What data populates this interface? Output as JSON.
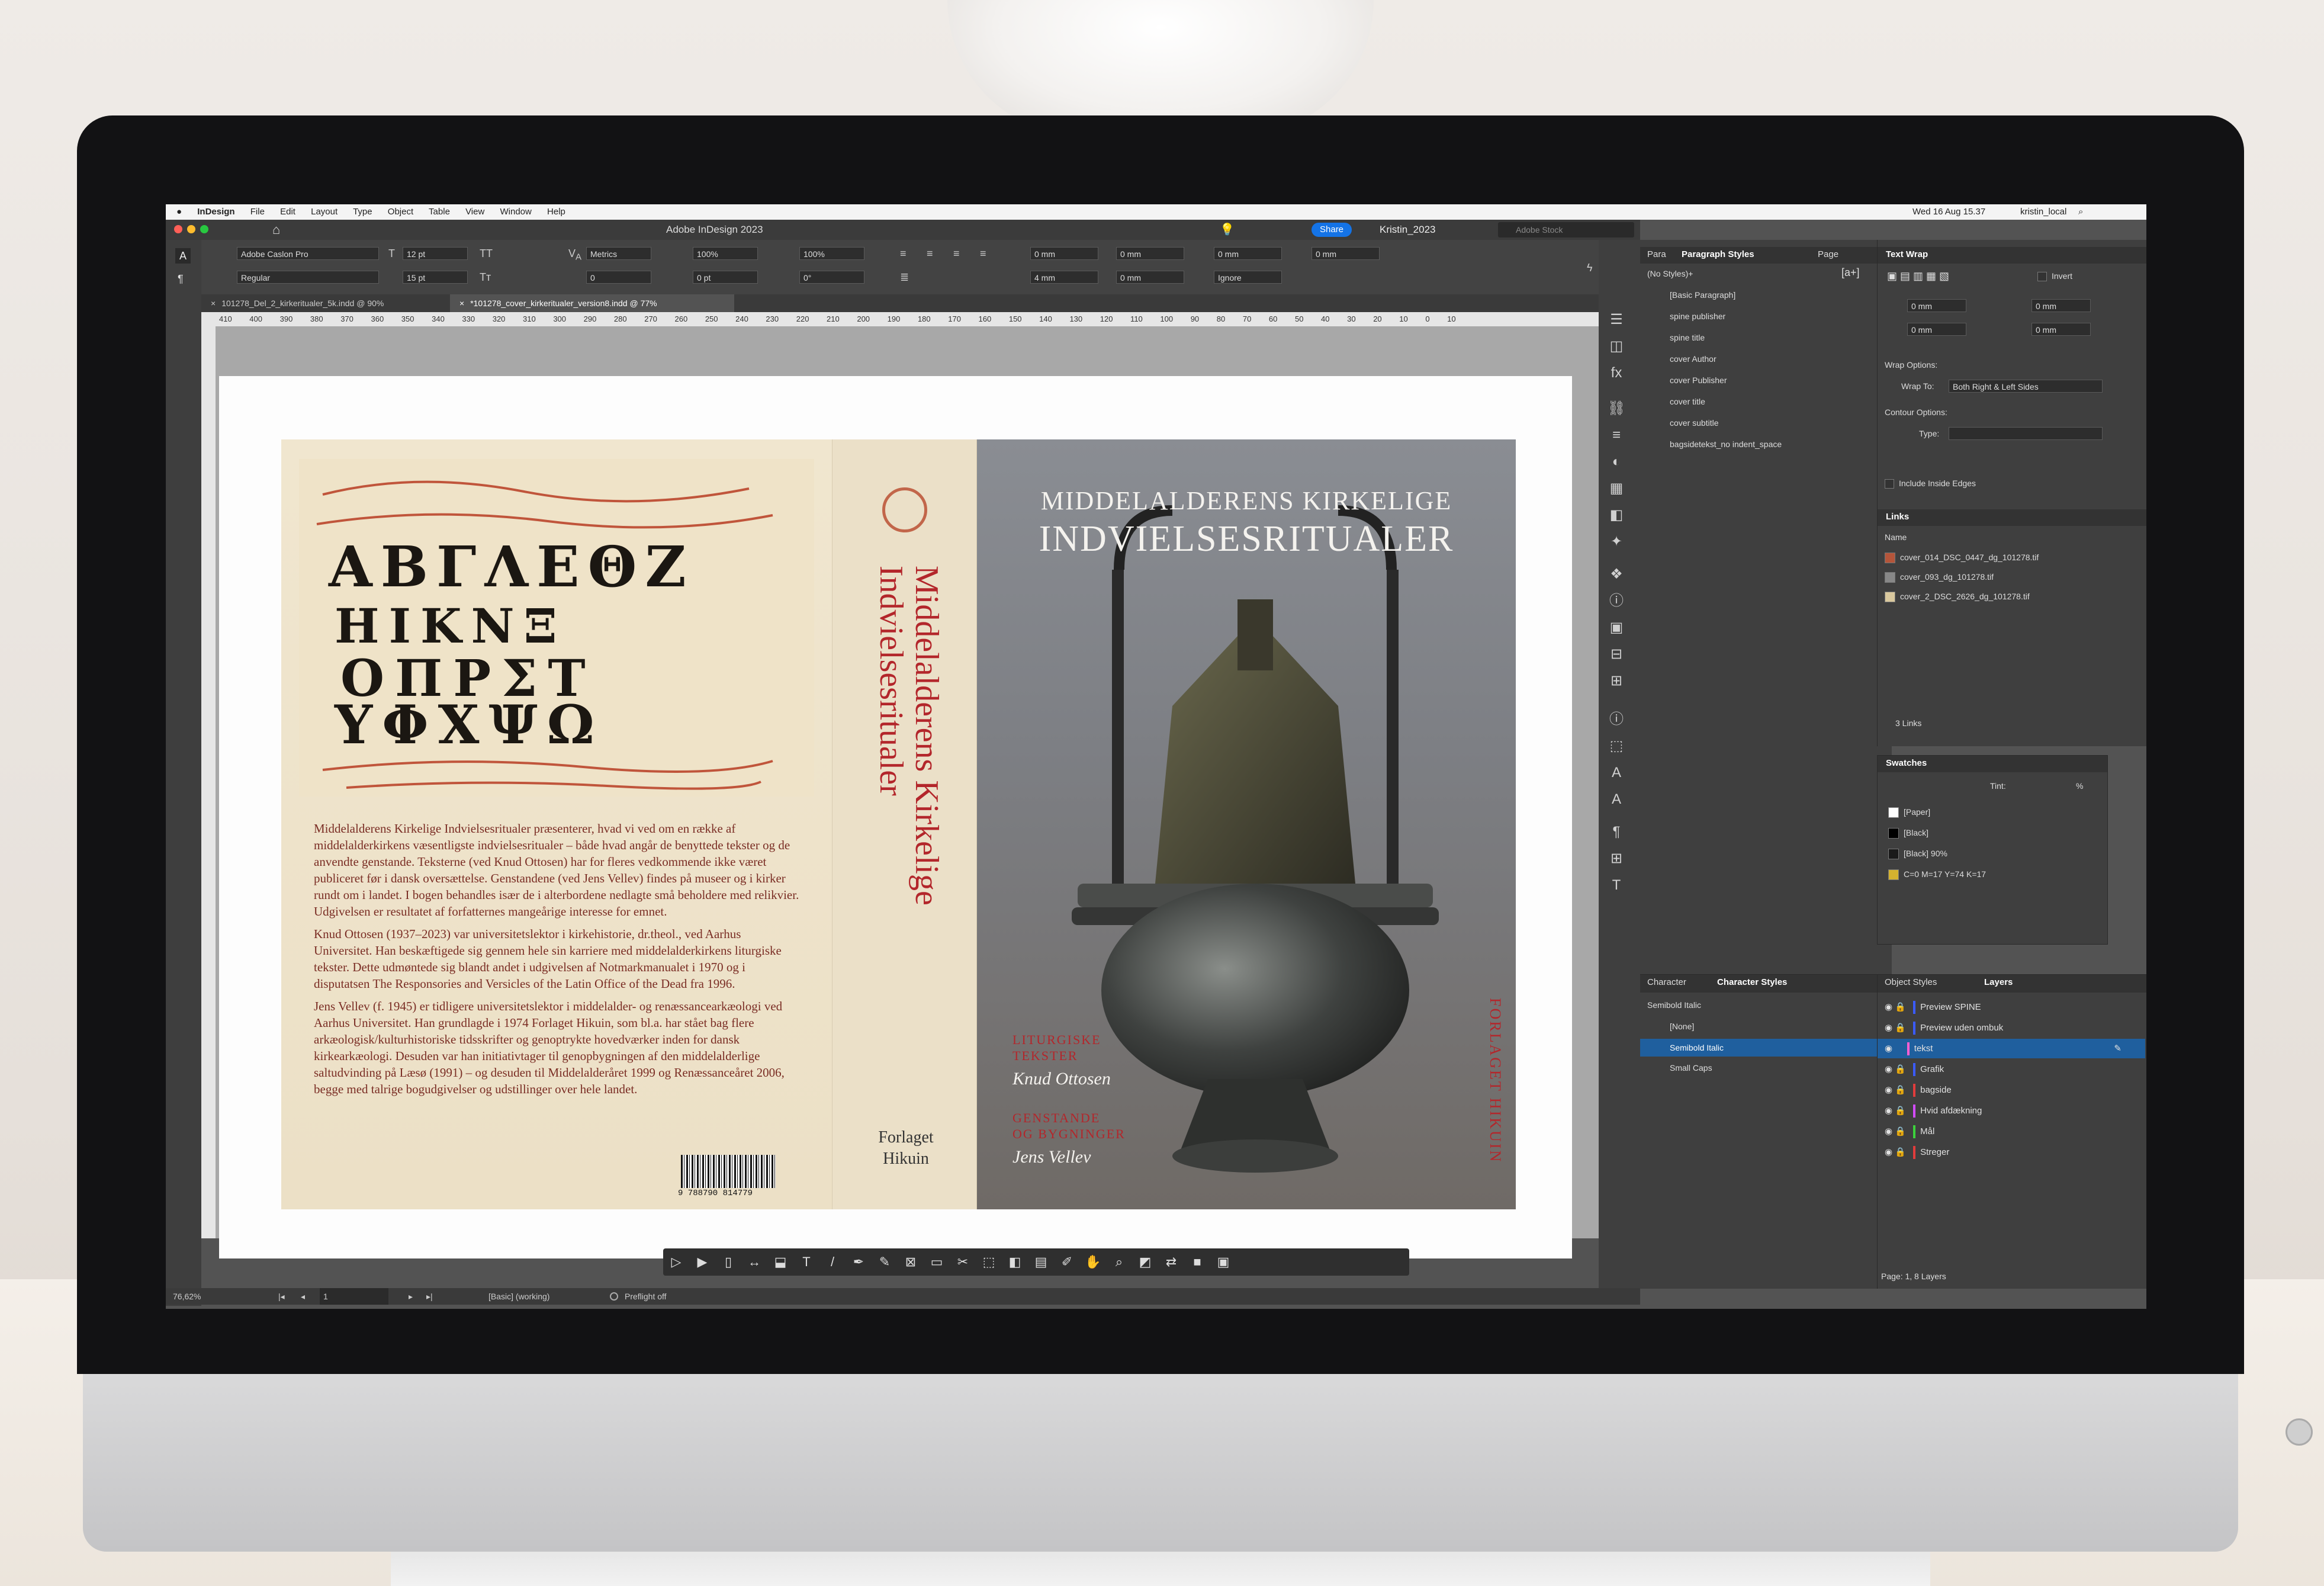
{
  "menubar": {
    "apple": "",
    "items": [
      "InDesign",
      "File",
      "Edit",
      "Layout",
      "Type",
      "Object",
      "Table",
      "View",
      "Window",
      "Help"
    ],
    "clock": "Wed 16 Aug 15.37",
    "user": "kristin_local"
  },
  "titlebar": {
    "title": "Adobe InDesign 2023",
    "share_label": "Share",
    "workspace": "Kristin_2023",
    "search_placeholder": "Adobe Stock"
  },
  "control": {
    "font_family": "Adobe Caslon Pro",
    "font_style": "Regular",
    "font_size": "12 pt",
    "leading": "15 pt",
    "kerning": "Metrics",
    "tracking": "0",
    "vscale": "100%",
    "hscale": "100%",
    "baseline": "0 pt",
    "skew": "0°",
    "indent_left": "0 mm",
    "indent_right": "0 mm",
    "first_line": "4 mm",
    "last_line": "0 mm",
    "space_before": "0 mm",
    "space_after": "0 mm",
    "grid_align": "Ignore"
  },
  "tabs": [
    {
      "label": "101278_Del_2_kirkeritualer_5k.indd @ 90%"
    },
    {
      "label": "*101278_cover_kirkeritualer_version8.indd @ 77%"
    }
  ],
  "ruler_ticks": "410 400 390 380 370 360 350 340 330 320 310 300 290 280 270 260 250 240 230 220 210 200 190 180 170 160 150 140 130 120 110 100 90 80 70 60 50 40 30 20 10 0 10",
  "status": {
    "zoom": "76,62%",
    "page": "1",
    "style": "[Basic] (working)",
    "preflight": "Preflight off"
  },
  "cover": {
    "back_paragraphs": [
      "Middelalderens Kirkelige Indvielsesritualer præsenterer, hvad vi ved om en række af middelalderkirkens væsentligste indvielsesritualer – både hvad angår de benyttede tekster og de anvendte genstande. Teksterne (ved Knud Ottosen) har for fleres vedkommende ikke været publiceret før i dansk oversættelse. Genstandene (ved Jens Vellev) findes på museer og i kirker rundt om i landet. I bogen behandles især de i alterbordene nedlagte små beholdere med relikvier. Udgivelsen er resultatet af forfatternes mangeårige interesse for emnet.",
      "Knud Ottosen (1937–2023) var universitetslektor i kirkehistorie, dr.theol., ved Aarhus Universitet. Han beskæftigede sig gennem hele sin karriere med middelalderkirkens liturgiske tekster. Dette udmøntede sig blandt andet i udgivelsen af Notmarkmanualet i 1970 og i disputatsen The Responsories and Versicles of the Latin Office of the Dead fra 1996.",
      "Jens Vellev (f. 1945) er tidligere universitetslektor i middelalder- og renæssancearkæologi ved Aarhus Universitet. Han grundlagde i 1974 Forlaget Hikuin, som bl.a. har stået bag flere arkæologisk/kulturhistoriske tidsskrifter og genoptrykte hovedværker inden for dansk kirkearkæologi. Desuden var han initiativtager til genopbygningen af den middelalderlige saltudvinding på Læsø (1991) – og desuden til Middelalderåret 1999 og Renæssanceåret 2006, begge med talrige bogudgivelser og udstillinger over hele landet."
    ],
    "isbn": "9 788790 814779",
    "spine_title_line1": "Middelalderens Kirkelige",
    "spine_title_line2": "Indvielsesritualer",
    "spine_publisher_1": "Forlaget",
    "spine_publisher_2": "Hikuin",
    "front_title_1": "MIDDELALDERENS KIRKELIGE",
    "front_title_2": "INDVIELSESRITUALER",
    "sub1_a": "LITURGISKE",
    "sub1_b": "TEKSTER",
    "author1": "Knud Ottosen",
    "sub2_a": "GENSTANDE",
    "sub2_b": "OG BYGNINGER",
    "author2": "Jens Vellev",
    "front_publisher": "FORLAGET HIKUIN"
  },
  "paragraph_styles": {
    "tab_para": "Para",
    "tab_label": "Paragraph Styles",
    "tab_page": "Page",
    "current": "(No Styles)+",
    "items": [
      "[Basic Paragraph]",
      "spine publisher",
      "spine title",
      "cover Author",
      "cover Publisher",
      "cover title",
      "cover subtitle",
      "bagsidetekst_no indent_space"
    ]
  },
  "text_wrap": {
    "title": "Text Wrap",
    "invert": "Invert",
    "top": "0 mm",
    "bottom": "0 mm",
    "left": "0 mm",
    "right": "0 mm",
    "wrap_options": "Wrap Options:",
    "wrap_to_label": "Wrap To:",
    "wrap_to": "Both Right & Left Sides",
    "contour_options": "Contour Options:",
    "type_label": "Type:",
    "include_inside": "Include Inside Edges"
  },
  "links": {
    "title": "Links",
    "col_name": "Name",
    "items": [
      "cover_014_DSC_0447_dg_101278.tif",
      "cover_093_dg_101278.tif",
      "cover_2_DSC_2626_dg_101278.tif"
    ],
    "count": "3 Links"
  },
  "swatches": {
    "title": "Swatches",
    "tint_label": "Tint:",
    "tint_unit": "%",
    "items": [
      {
        "name": "[Paper]",
        "color": "#ffffff"
      },
      {
        "name": "[Black]",
        "color": "#000000"
      },
      {
        "name": "[Black] 90%",
        "color": "#1a1a1a"
      },
      {
        "name": "C=0 M=17 Y=74 K=17",
        "color": "#d4b22f"
      }
    ]
  },
  "character_styles": {
    "tab_char": "Character",
    "tab_label": "Character Styles",
    "current": "Semibold Italic",
    "items": [
      "[None]",
      "Semibold Italic",
      "Small Caps"
    ],
    "selected": "Semibold Italic"
  },
  "layers": {
    "tab_object": "Object Styles",
    "tab_label": "Layers",
    "items": [
      {
        "name": "Preview SPINE",
        "color": "#3b5bff"
      },
      {
        "name": "Preview uden ombuk",
        "color": "#3b5bff"
      },
      {
        "name": "tekst",
        "color": "#ff5fd2"
      },
      {
        "name": "Grafik",
        "color": "#3b5bff"
      },
      {
        "name": "bagside",
        "color": "#e23c3c"
      },
      {
        "name": "Hvid afdækning",
        "color": "#d34bff"
      },
      {
        "name": "Mål",
        "color": "#3cd23c"
      },
      {
        "name": "Streger",
        "color": "#e23c3c"
      }
    ],
    "selected": "tekst",
    "footer": "Page: 1, 8 Layers"
  }
}
